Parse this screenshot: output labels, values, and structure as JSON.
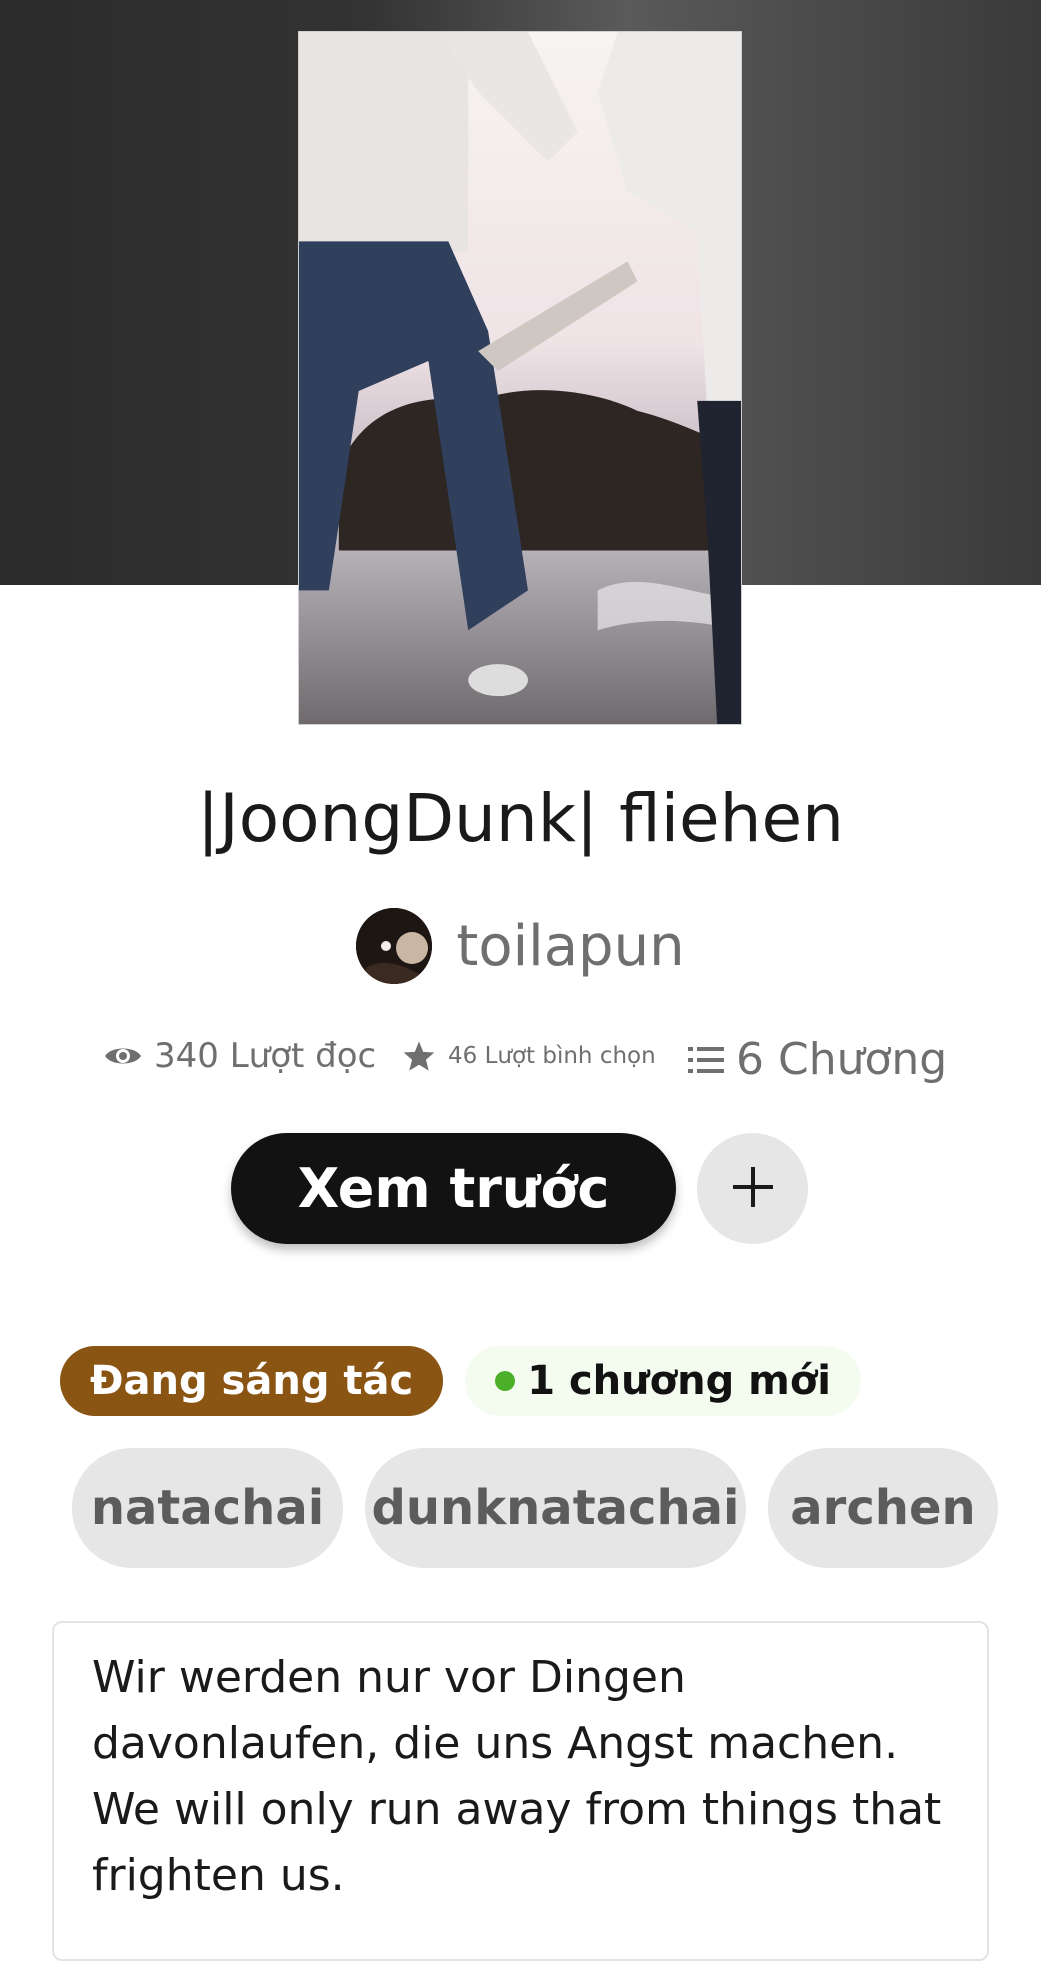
{
  "story": {
    "title": "|JoongDunk| fliehen",
    "author": "toilapun"
  },
  "stats": {
    "reads": "340 Lượt đọc",
    "votes": "46 Lượt bình chọn",
    "parts": "6 Chương"
  },
  "actions": {
    "read_label": "Xem trước",
    "add_label": "+"
  },
  "badges": {
    "status": "Đang sáng tác",
    "new_parts": "1 chương mới"
  },
  "tags": [
    "natachai",
    "dunknatachai",
    "archen"
  ],
  "description": {
    "line1": "Wir werden nur vor Dingen",
    "line2": "davonlaufen, die uns Angst machen.",
    "line3": "We will only run away from things that",
    "line4": "frighten us."
  },
  "colors": {
    "status_badge": "#8a5413",
    "new_dot": "#4caf2a",
    "primary_button": "#121212"
  },
  "icons": {
    "reads": "eye-icon",
    "votes": "star-icon",
    "parts": "list-icon",
    "add": "plus-icon"
  }
}
